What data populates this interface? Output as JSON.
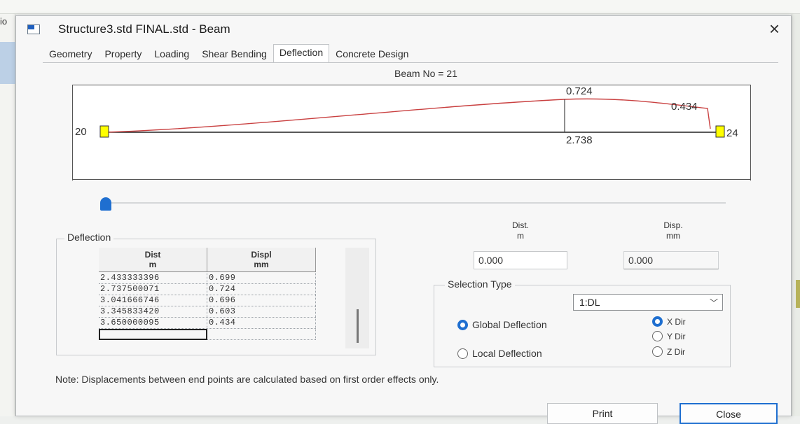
{
  "background": {
    "left_label": "io"
  },
  "window": {
    "title": "Structure3.std FINAL.std - Beam",
    "close_glyph": "×"
  },
  "tabs": [
    {
      "label": "Geometry"
    },
    {
      "label": "Property"
    },
    {
      "label": "Loading"
    },
    {
      "label": "Shear Bending"
    },
    {
      "label": "Deflection"
    },
    {
      "label": "Concrete Design"
    }
  ],
  "active_tab": "Deflection",
  "diagram": {
    "beam_no": "Beam No = 21",
    "start_node": "20",
    "end_node": "24",
    "max_value": "0.724",
    "end_value": "0.434",
    "max_dist": "2.738",
    "colors": {
      "curve": "#c94040",
      "support": "#ffff00"
    }
  },
  "slider": {
    "position": 0.0
  },
  "deflection_group": {
    "label": "Deflection",
    "grid": {
      "headers": [
        {
          "line1": "Dist",
          "line2": "m"
        },
        {
          "line1": "Displ",
          "line2": "mm"
        }
      ],
      "rows": [
        [
          "2.433333396",
          "0.699"
        ],
        [
          "2.737500071",
          "0.724"
        ],
        [
          "3.041666746",
          "0.696"
        ],
        [
          "3.345833420",
          "0.603"
        ],
        [
          "3.650000095",
          "0.434"
        ],
        [
          "",
          ""
        ]
      ]
    }
  },
  "dist_field": {
    "label_line1": "Dist.",
    "label_line2": "m",
    "value": "0.000"
  },
  "disp_field": {
    "label_line1": "Disp.",
    "label_line2": "mm",
    "value": "0.000"
  },
  "selection_type": {
    "label": "Selection Type",
    "selected": "1:DL",
    "caret": "﹀"
  },
  "deflection_type": {
    "global": "Global Deflection",
    "local": "Local Deflection",
    "selected": "global"
  },
  "direction": {
    "x": "X Dir",
    "y": "Y Dir",
    "z": "Z Dir",
    "selected": "x"
  },
  "note": "Note: Displacements between end points are calculated based on first order effects only.",
  "buttons": {
    "print": "Print",
    "close": "Close"
  }
}
